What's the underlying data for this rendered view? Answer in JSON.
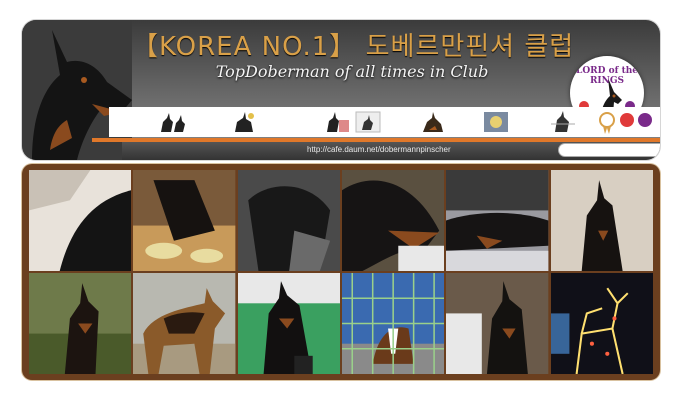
{
  "banner": {
    "title": "【KOREA NO.1】 도베르만핀셔 클럽",
    "subtitle": "TopDoberman of all times in Club",
    "badge_text": "LORD of the RINGS",
    "url": "http://cafe.daum.net/dobermannpinscher"
  },
  "search": {
    "placeholder": ""
  },
  "colors": {
    "title": "#d9a048",
    "accent_orange": "#e0782a",
    "frame_brown": "#6b3f1f",
    "banner_dark": "#3b3b3b"
  },
  "icons": [
    "doberman-pair-icon",
    "doberman-icon",
    "doberman-pair-icon",
    "doberman-icon",
    "doberman-icon",
    "award-icon",
    "doberman-icon",
    "medal-ribbons-icon"
  ],
  "gallery": {
    "tiles": [
      "doberman-close-up-photo",
      "doberman-kitchen-photo",
      "doberman-sofa-photo",
      "doberman-face-photo",
      "doberman-lying-photo",
      "doberman-sitting-photo",
      "doberman-outdoor-photo",
      "german-shepherd-photo",
      "doberman-green-yard-photo",
      "boxer-in-kennel-photo",
      "doberman-indoor-photo",
      "christmas-lights-reindeer-photo"
    ]
  }
}
